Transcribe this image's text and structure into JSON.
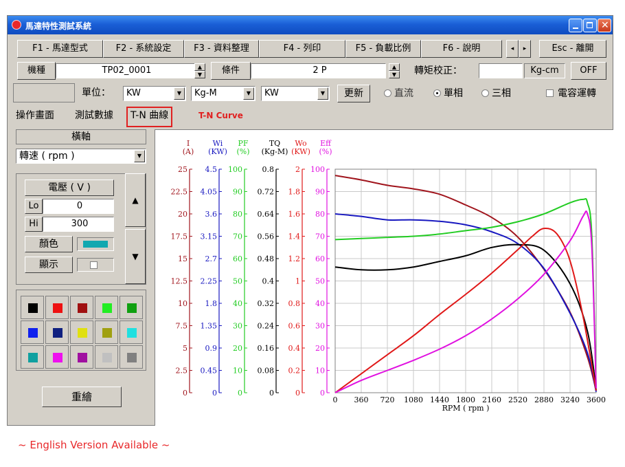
{
  "window": {
    "title": "馬達特性測試系統"
  },
  "toolbar": {
    "f1": "F1 - 馬達型式",
    "f2": "F2 - 系統設定",
    "f3": "F3 - 資料整理",
    "f4": "F4 - 列印",
    "f5": "F5 - 負載比例",
    "f6": "F6 - 說明",
    "esc": "Esc - 離開"
  },
  "params": {
    "model_label": "機種",
    "model_value": "TP02_0001",
    "condition_label": "條件",
    "condition_value": "2 P",
    "torque_cal_label": "轉矩校正：",
    "torque_cal_value": "",
    "torque_unit": "Kg-cm",
    "off_button": "OFF"
  },
  "units": {
    "label": "單位：",
    "unit1": "KW",
    "unit2": "Kg-M",
    "unit3": "KW",
    "update_button": "更新",
    "radio_dc": "直流",
    "radio_single": "單相",
    "radio_three": "三相",
    "capacitor_label": "電容運轉"
  },
  "tabs": {
    "operation": "操作畫面",
    "test_data": "測試數據",
    "tn_curve": "T-N 曲線",
    "annotation": "T-N Curve"
  },
  "left": {
    "xaxis_label": "橫軸",
    "xaxis_value": "轉速 ( rpm )",
    "voltage_title": "電壓 ( V )",
    "lo_label": "Lo",
    "lo_value": "0",
    "hi_label": "Hi",
    "hi_value": "300",
    "color_label": "顏色",
    "display_label": "顯示",
    "redraw_button": "重繪",
    "palette": [
      "#000000",
      "#ee1111",
      "#a01010",
      "#22ee22",
      "#10a010",
      "#1020ee",
      "#102080",
      "#e0e010",
      "#a0a010",
      "#20e0e0",
      "#10a0a0",
      "#ee10ee",
      "#a010a0",
      "#c0c0c0",
      "#808080"
    ],
    "selected_color": "#10a8b0"
  },
  "footer": {
    "text": "~ English Version Available ~"
  },
  "chart_data": {
    "type": "line",
    "xlabel": "RPM ( rpm )",
    "xlim": [
      0,
      3600
    ],
    "xticks": [
      "0",
      "360",
      "720",
      "1080",
      "1440",
      "1800",
      "2160",
      "2520",
      "2880",
      "3240",
      "3600"
    ],
    "axes": [
      {
        "name": "I",
        "unit": "(A)",
        "color": "#a0141c",
        "ticks": [
          "0",
          "2.5",
          "5",
          "7.5",
          "10",
          "12.5",
          "15",
          "17.5",
          "20",
          "22.5",
          "25"
        ]
      },
      {
        "name": "Wi",
        "unit": "(KW)",
        "color": "#1818c0",
        "ticks": [
          "0",
          "0.45",
          "0.9",
          "1.35",
          "1.8",
          "2.25",
          "2.7",
          "3.15",
          "3.6",
          "4.05",
          "4.5"
        ]
      },
      {
        "name": "PF",
        "unit": "(%)",
        "color": "#22cc22",
        "ticks": [
          "0",
          "10",
          "20",
          "30",
          "40",
          "50",
          "60",
          "70",
          "80",
          "90",
          "100"
        ]
      },
      {
        "name": "TQ",
        "unit": "(Kg-M)",
        "color": "#000000",
        "ticks": [
          "0",
          "0.08",
          "0.16",
          "0.24",
          "0.32",
          "0.4",
          "0.48",
          "0.56",
          "0.64",
          "0.72",
          "0.8"
        ]
      },
      {
        "name": "Wo",
        "unit": "(KW)",
        "color": "#e01818",
        "ticks": [
          "0",
          "0.2",
          "0.4",
          "0.6",
          "0.8",
          "1",
          "1.2",
          "1.4",
          "1.6",
          "1.8",
          "2"
        ]
      },
      {
        "name": "Eff",
        "unit": "(%)",
        "color": "#e010e0",
        "ticks": [
          "0",
          "10",
          "20",
          "30",
          "40",
          "50",
          "60",
          "70",
          "80",
          "90",
          "100"
        ]
      }
    ],
    "series": [
      {
        "name": "I",
        "color": "#a0141c",
        "axis": "I",
        "x": [
          0,
          360,
          720,
          1080,
          1440,
          1800,
          2160,
          2520,
          2880,
          3240,
          3480,
          3600
        ],
        "y": [
          24.3,
          23.8,
          23.2,
          22.8,
          22.2,
          21,
          19.6,
          17.4,
          13.8,
          9,
          4,
          0.2
        ]
      },
      {
        "name": "Wi",
        "color": "#1818c0",
        "axis": "Wi",
        "x": [
          0,
          360,
          720,
          1080,
          1440,
          1800,
          2160,
          2520,
          2880,
          3240,
          3480,
          3600
        ],
        "y": [
          3.6,
          3.55,
          3.48,
          3.48,
          3.45,
          3.38,
          3.24,
          3.0,
          2.5,
          1.6,
          0.8,
          0.02
        ]
      },
      {
        "name": "PF",
        "color": "#22cc22",
        "axis": "PF",
        "x": [
          0,
          360,
          720,
          1080,
          1440,
          1800,
          2160,
          2520,
          2880,
          3240,
          3420,
          3480,
          3540,
          3600
        ],
        "y": [
          68.5,
          69,
          69.5,
          70,
          71,
          72.5,
          74,
          76.5,
          80,
          85,
          86.5,
          85,
          70,
          2
        ]
      },
      {
        "name": "TQ",
        "color": "#000000",
        "axis": "TQ",
        "x": [
          0,
          360,
          720,
          1080,
          1440,
          1800,
          2160,
          2520,
          2880,
          3240,
          3480,
          3600
        ],
        "y": [
          0.45,
          0.44,
          0.44,
          0.45,
          0.47,
          0.49,
          0.52,
          0.53,
          0.51,
          0.39,
          0.22,
          0.01
        ]
      },
      {
        "name": "Wo",
        "color": "#e01818",
        "axis": "Wo",
        "x": [
          0,
          360,
          720,
          1080,
          1440,
          1800,
          2160,
          2520,
          2720,
          2880,
          3060,
          3240,
          3420,
          3600
        ],
        "y": [
          0,
          0.17,
          0.34,
          0.51,
          0.7,
          0.88,
          1.07,
          1.28,
          1.4,
          1.47,
          1.42,
          1.18,
          0.68,
          0.02
        ]
      },
      {
        "name": "Eff",
        "color": "#e010e0",
        "axis": "Eff",
        "x": [
          0,
          360,
          720,
          1080,
          1440,
          1800,
          2160,
          2520,
          2880,
          3240,
          3420,
          3480,
          3540,
          3600
        ],
        "y": [
          0,
          5.5,
          10,
          14.5,
          19.5,
          25.5,
          33,
          42,
          53,
          68,
          79,
          80,
          65,
          2
        ]
      }
    ]
  }
}
